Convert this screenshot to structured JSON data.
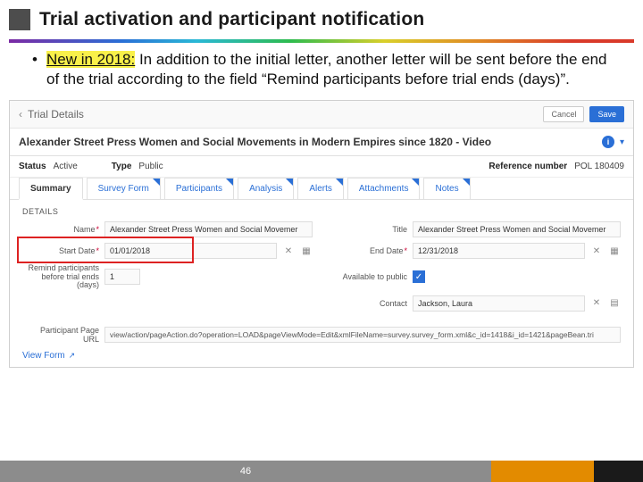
{
  "slide": {
    "title": "Trial activation and participant notification",
    "bullet_new": "New in 2018:",
    "bullet_rest": " In addition to the initial letter, another letter will be sent before the end of the trial according to the field “Remind participants before trial ends (days)”."
  },
  "header": {
    "back_label": "Trial Details",
    "cancel": "Cancel",
    "save": "Save"
  },
  "record": {
    "title": "Alexander Street Press Women and Social Movements in Modern Empires since 1820 - Video",
    "status_label": "Status",
    "status_value": "Active",
    "type_label": "Type",
    "type_value": "Public",
    "ref_label": "Reference number",
    "ref_value": "POL 180409"
  },
  "tabs": [
    "Summary",
    "Survey Form",
    "Participants",
    "Analysis",
    "Alerts",
    "Attachments",
    "Notes"
  ],
  "section": "DETAILS",
  "form": {
    "name_label": "Name",
    "name_value": "Alexander Street Press Women and Social Movemer",
    "title_label": "Title",
    "title_value": "Alexander Street Press Women and Social Movemer",
    "start_label": "Start Date",
    "start_value": "01/01/2018",
    "end_label": "End Date",
    "end_value": "12/31/2018",
    "remind_label": "Remind participants before trial ends (days)",
    "remind_value": "1",
    "avail_label": "Available to public",
    "contact_label": "Contact",
    "contact_value": "Jackson, Laura",
    "ppu_label": "Participant Page URL",
    "ppu_value": "view/action/pageAction.do?operation=LOAD&pageViewMode=Edit&xmlFileName=survey.survey_form.xml&c_id=1418&i_id=1421&pageBean.tri",
    "view_form": "View Form"
  },
  "footer": {
    "page": "46"
  }
}
